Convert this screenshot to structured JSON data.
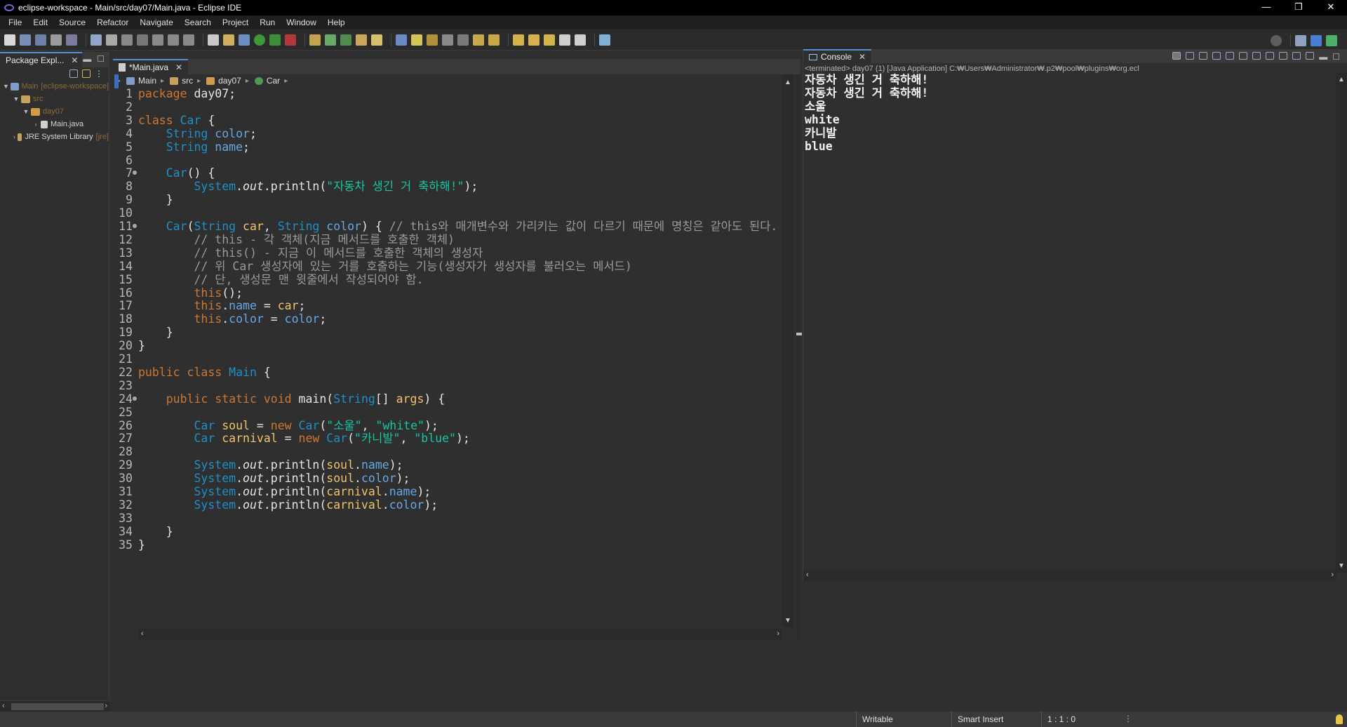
{
  "window": {
    "title": "eclipse-workspace - Main/src/day07/Main.java - Eclipse IDE",
    "controls": [
      "—",
      "❐",
      "✕"
    ]
  },
  "menu": [
    "File",
    "Edit",
    "Source",
    "Refactor",
    "Navigate",
    "Search",
    "Project",
    "Run",
    "Window",
    "Help"
  ],
  "package_explorer": {
    "tab_label": "Package Expl...",
    "tree": [
      {
        "label": "Main",
        "suffix": "[eclipse-workspace]",
        "expanded": true
      },
      {
        "label": "src",
        "expanded": true
      },
      {
        "label": "day07",
        "expanded": true
      },
      {
        "label": "Main.java",
        "expanded": false
      },
      {
        "label": "JRE System Library",
        "suffix": "[jre]",
        "expanded": false
      }
    ]
  },
  "editor": {
    "tab_label": "*Main.java",
    "breadcrumb": [
      "Main",
      "src",
      "day07",
      "Car"
    ],
    "lines": [
      {
        "n": "1",
        "code": "package day07;"
      },
      {
        "n": "2",
        "code": ""
      },
      {
        "n": "3",
        "code": "class Car {"
      },
      {
        "n": "4",
        "code": "    String color;"
      },
      {
        "n": "5",
        "code": "    String name;"
      },
      {
        "n": "6",
        "code": ""
      },
      {
        "n": "7",
        "code": "    Car() {"
      },
      {
        "n": "8",
        "code": "        System.out.println(\"자동차 생긴 거 축하해!\");"
      },
      {
        "n": "9",
        "code": "    }"
      },
      {
        "n": "10",
        "code": ""
      },
      {
        "n": "11",
        "code": "    Car(String car, String color) { // this와 매개변수와 가리키는 값이 다르기 때문에 명칭은 같아도 된다."
      },
      {
        "n": "12",
        "code": "        // this - 각 객체(지금 메서드를 호출한 객체)"
      },
      {
        "n": "13",
        "code": "        // this() - 지금 이 메서드를 호출한 객체의 생성자"
      },
      {
        "n": "14",
        "code": "        // 위 Car 생성자에 있는 거를 호출하는 기능(생성자가 생성자를 불러오는 메서드)"
      },
      {
        "n": "15",
        "code": "        // 단, 생성문 맨 윗줄에서 작성되어야 함."
      },
      {
        "n": "16",
        "code": "        this();"
      },
      {
        "n": "17",
        "code": "        this.name = car;"
      },
      {
        "n": "18",
        "code": "        this.color = color;"
      },
      {
        "n": "19",
        "code": "    }"
      },
      {
        "n": "20",
        "code": "}"
      },
      {
        "n": "21",
        "code": ""
      },
      {
        "n": "22",
        "code": "public class Main {"
      },
      {
        "n": "23",
        "code": ""
      },
      {
        "n": "24",
        "code": "    public static void main(String[] args) {"
      },
      {
        "n": "25",
        "code": ""
      },
      {
        "n": "26",
        "code": "        Car soul = new Car(\"소울\", \"white\");"
      },
      {
        "n": "27",
        "code": "        Car carnival = new Car(\"카니발\", \"blue\");"
      },
      {
        "n": "28",
        "code": ""
      },
      {
        "n": "29",
        "code": "        System.out.println(soul.name);"
      },
      {
        "n": "30",
        "code": "        System.out.println(soul.color);"
      },
      {
        "n": "31",
        "code": "        System.out.println(carnival.name);"
      },
      {
        "n": "32",
        "code": "        System.out.println(carnival.color);"
      },
      {
        "n": "33",
        "code": ""
      },
      {
        "n": "34",
        "code": "    }"
      },
      {
        "n": "35",
        "code": "}"
      }
    ]
  },
  "console": {
    "tab_label": "Console",
    "status": "<terminated> day07 (1) [Java Application] C:₩Users₩Administrator₩.p2₩pool₩plugins₩org.ecl",
    "output": [
      "자동차 생긴 거 축하해!",
      "자동차 생긴 거 축하해!",
      "소울",
      "white",
      "카니발",
      "blue"
    ]
  },
  "statusbar": {
    "writable": "Writable",
    "insert_mode": "Smart Insert",
    "position": "1 : 1 : 0"
  },
  "colors": {
    "keyword": "#cc7832",
    "type": "#1e90c8",
    "string": "#17c6a3",
    "comment": "#9a9a9a",
    "field": "#66a9e6",
    "local_var": "#f2c36b"
  }
}
